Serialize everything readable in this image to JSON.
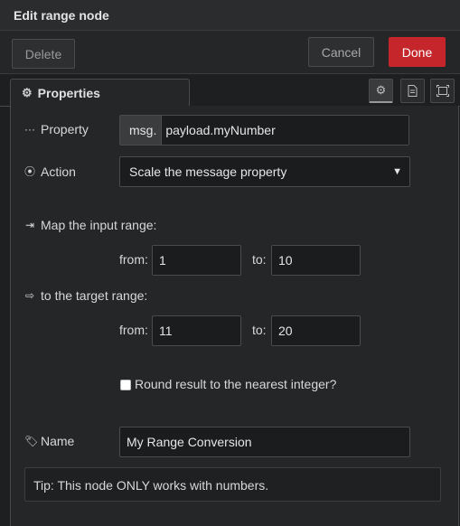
{
  "dialog": {
    "title": "Edit range node"
  },
  "toolbar": {
    "delete_label": "Delete",
    "cancel_label": "Cancel",
    "done_label": "Done"
  },
  "tabs": {
    "properties_label": "Properties",
    "icons": [
      "gear-icon",
      "document-icon",
      "frame-icon"
    ]
  },
  "form": {
    "property": {
      "label": "Property",
      "prefix": "msg.",
      "value": "payload.myNumber"
    },
    "action": {
      "label": "Action",
      "selected": "Scale the message property"
    },
    "input_range": {
      "label": "Map the input range:",
      "from_label": "from:",
      "from_value": "1",
      "to_label": "to:",
      "to_value": "10"
    },
    "target_range": {
      "label": "to the target range:",
      "from_label": "from:",
      "from_value": "11",
      "to_label": "to:",
      "to_value": "20"
    },
    "round": {
      "label": "Round result to the nearest integer?",
      "checked": false
    },
    "name": {
      "label": "Name",
      "value": "My Range Conversion"
    },
    "tip": "Tip: This node ONLY works with numbers."
  },
  "colors": {
    "accent_done": "#c4262c",
    "background": "#1e1f21",
    "panel": "#252628"
  }
}
